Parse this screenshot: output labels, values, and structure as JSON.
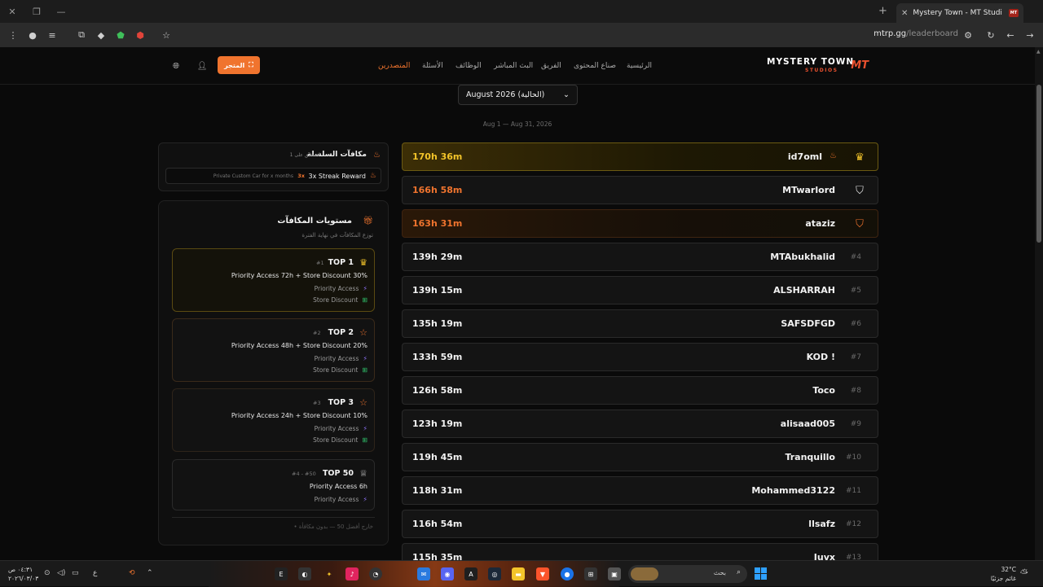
{
  "browser": {
    "tab_title": "Mystery Town - MT Studios | MT",
    "tab_favicon": "MT",
    "url_domain": "mtrp.gg",
    "url_path": "/leaderboard"
  },
  "site": {
    "logo_name": "MYSTERY TOWN",
    "logo_sub": "STUDIOS",
    "logo_mark": "MT",
    "nav": [
      {
        "label": "الرئيسية",
        "active": false
      },
      {
        "label": "صناع المحتوى",
        "active": false
      },
      {
        "label": "الفريق",
        "active": false
      },
      {
        "label": "البث المباشر",
        "active": false
      },
      {
        "label": "الوظائف",
        "active": false
      },
      {
        "label": "الأسئلة",
        "active": false
      },
      {
        "label": "المتصدرين",
        "active": true
      }
    ],
    "store_label": "المتجر"
  },
  "period": {
    "selected": "August 2026 (الحالية)",
    "range": "Aug 1 — Aug 31, 2026"
  },
  "streak": {
    "title": "مكافآت السلسلة",
    "badge": "محقق على 1#",
    "reward_label": "3x Streak Reward",
    "reward_mult": "3x",
    "reward_desc": "Private Custom Car for x months"
  },
  "tiers": {
    "title": "مستويات المكافآت",
    "subtitle": "توزع المكافآت في نهاية الفترة",
    "items": [
      {
        "name": "TOP 1",
        "rank": "#1",
        "desc": "Priority Access 72h + Store Discount 30%",
        "perks": [
          "Priority Access",
          "Store Discount"
        ]
      },
      {
        "name": "TOP 2",
        "rank": "#2",
        "desc": "Priority Access 48h + Store Discount 20%",
        "perks": [
          "Priority Access",
          "Store Discount"
        ]
      },
      {
        "name": "TOP 3",
        "rank": "#3",
        "desc": "Priority Access 24h + Store Discount 10%",
        "perks": [
          "Priority Access",
          "Store Discount"
        ]
      },
      {
        "name": "TOP 50",
        "rank": "#4 - #50",
        "desc": "Priority Access 6h",
        "perks": [
          "Priority Access"
        ]
      }
    ],
    "outside_note": "• خارج أفضل 50 — بدون مكافأة"
  },
  "leaderboard": [
    {
      "rank": "#1",
      "name": "id7oml",
      "time": "170h 36m"
    },
    {
      "rank": "#2",
      "name": "MTwarlord",
      "time": "166h 58m"
    },
    {
      "rank": "#3",
      "name": "ataziz",
      "time": "163h 31m"
    },
    {
      "rank": "#4",
      "name": "MTAbukhalid",
      "time": "139h 29m"
    },
    {
      "rank": "#5",
      "name": "ALSHARRAH",
      "time": "139h 15m"
    },
    {
      "rank": "#6",
      "name": "SAFSDFGD",
      "time": "135h 19m"
    },
    {
      "rank": "#7",
      "name": "KOD !",
      "time": "133h 59m"
    },
    {
      "rank": "#8",
      "name": "Toco",
      "time": "126h 58m"
    },
    {
      "rank": "#9",
      "name": "alisaad005",
      "time": "123h 19m"
    },
    {
      "rank": "#10",
      "name": "Tranquillo",
      "time": "119h 45m"
    },
    {
      "rank": "#11",
      "name": "Mohammed3122",
      "time": "118h 31m"
    },
    {
      "rank": "#12",
      "name": "llsafz",
      "time": "116h 54m"
    },
    {
      "rank": "#13",
      "name": "Juvx",
      "time": "115h 35m"
    }
  ],
  "taskbar": {
    "search_label": "بحث",
    "clock_time": "٠٤:٣١ ص",
    "clock_date": "٢٠٢٦/٠٣/٠٣",
    "weather_temp": "32°C",
    "weather_desc": "غائم جزئيًا",
    "lang": "ع"
  }
}
